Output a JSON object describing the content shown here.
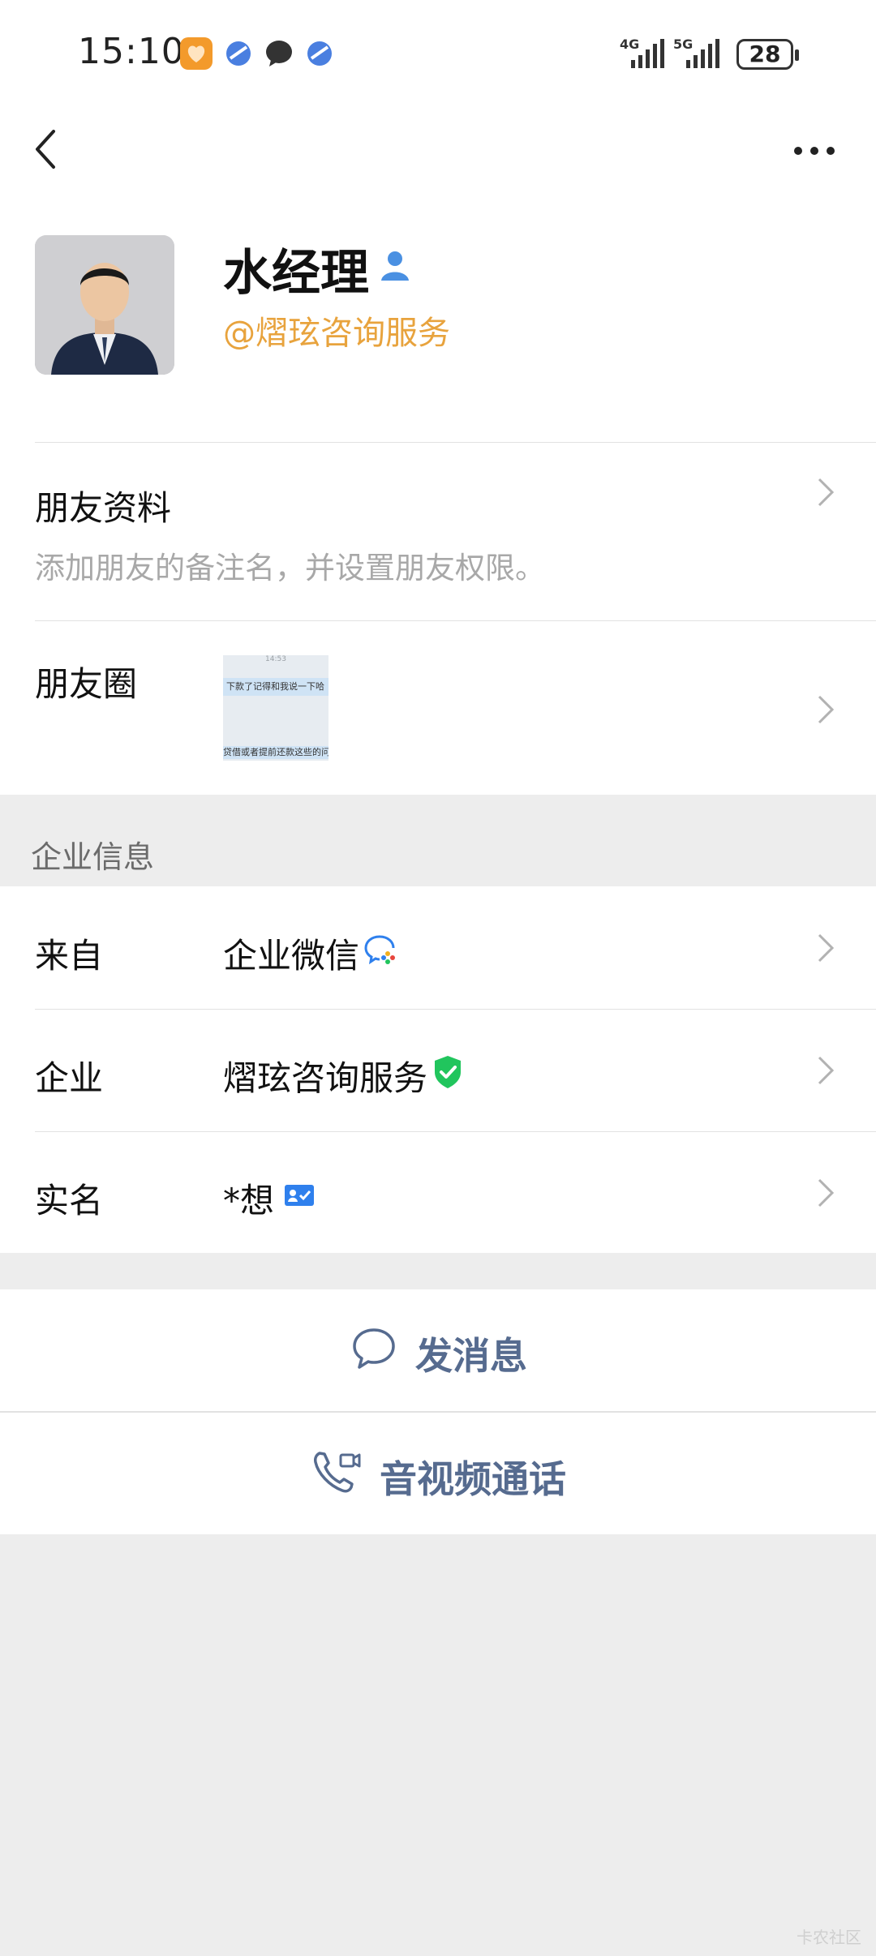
{
  "status_bar": {
    "time": "15:10",
    "network_1": "4G",
    "network_2": "5G",
    "battery": "28"
  },
  "profile": {
    "name": "水经理",
    "company_tag": "@熠玹咨询服务"
  },
  "friend_info": {
    "title": "朋友资料",
    "subtitle": "添加朋友的备注名，并设置朋友权限。"
  },
  "moments": {
    "label": "朋友圈",
    "thumb_time": "14:53",
    "thumb_line_1": "下款了记得和我说一下哈",
    "thumb_line_2": "贷借或者提前还款这些的问"
  },
  "enterprise": {
    "section_title": "企业信息",
    "rows": [
      {
        "label": "来自",
        "value": "企业微信",
        "icon": "wecom-icon"
      },
      {
        "label": "企业",
        "value": "熠玹咨询服务",
        "icon": "verified-shield-icon"
      },
      {
        "label": "实名",
        "value": "*想",
        "icon": "realname-card-icon"
      }
    ]
  },
  "actions": {
    "message": "发消息",
    "call": "音视频通话"
  },
  "watermark": "卡农社区",
  "colors": {
    "accent_orange": "#e8a33d",
    "action_blue": "#566b8f",
    "verified_green": "#21c55d",
    "background": "#ededed"
  }
}
